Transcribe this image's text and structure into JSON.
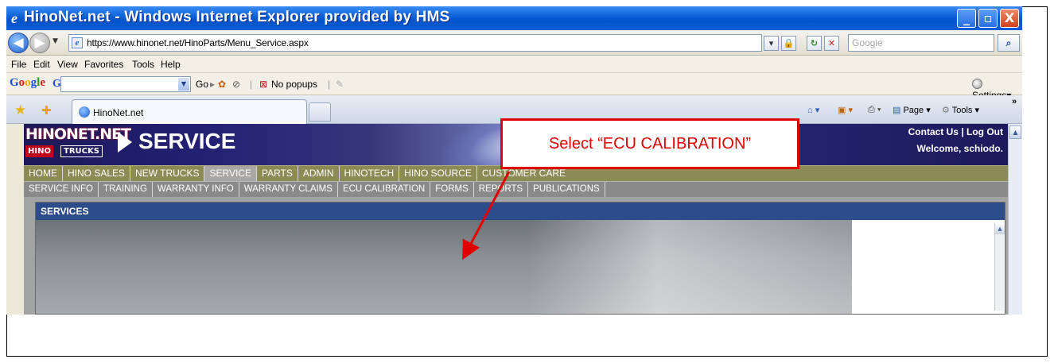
{
  "window": {
    "title": "HinoNet.net - Windows Internet Explorer provided by HMS",
    "min": "_",
    "max": "▫",
    "close": "X"
  },
  "address": {
    "url": "https://www.hinonet.net/HinoParts/Menu_Service.aspx",
    "search_placeholder": "Google"
  },
  "menubar": [
    "File",
    "Edit",
    "View",
    "Favorites",
    "Tools",
    "Help"
  ],
  "google_bar": {
    "logo": "Google",
    "logo_g": "G",
    "go": "Go",
    "popups": "No popups",
    "settings": "Settings"
  },
  "tabs": {
    "active_label": "HinoNet.net"
  },
  "ie_toolbar": {
    "page": "Page",
    "tools": "Tools",
    "more": "»"
  },
  "site": {
    "logo_top": "HINONET.NET",
    "logo_hino": "HINO",
    "logo_trucks": "TRUCKS",
    "section_title": "SERVICE",
    "top_links": "Contact Us | Log Out",
    "welcome": "Welcome, schiodo.",
    "nav_primary": [
      "HOME",
      "HINO SALES",
      "NEW TRUCKS",
      "SERVICE",
      "PARTS",
      "ADMIN",
      "HINOTECH",
      "HINO SOURCE",
      "CUSTOMER CARE"
    ],
    "nav_primary_active": "SERVICE",
    "nav_secondary": [
      "SERVICE INFO",
      "TRAINING",
      "WARRANTY INFO",
      "WARRANTY CLAIMS",
      "ECU CALIBRATION",
      "FORMS",
      "REPORTS",
      "PUBLICATIONS"
    ],
    "content_header": "SERVICES"
  },
  "callout": {
    "text": "Select “ECU CALIBRATION”",
    "color": "#e00000"
  }
}
